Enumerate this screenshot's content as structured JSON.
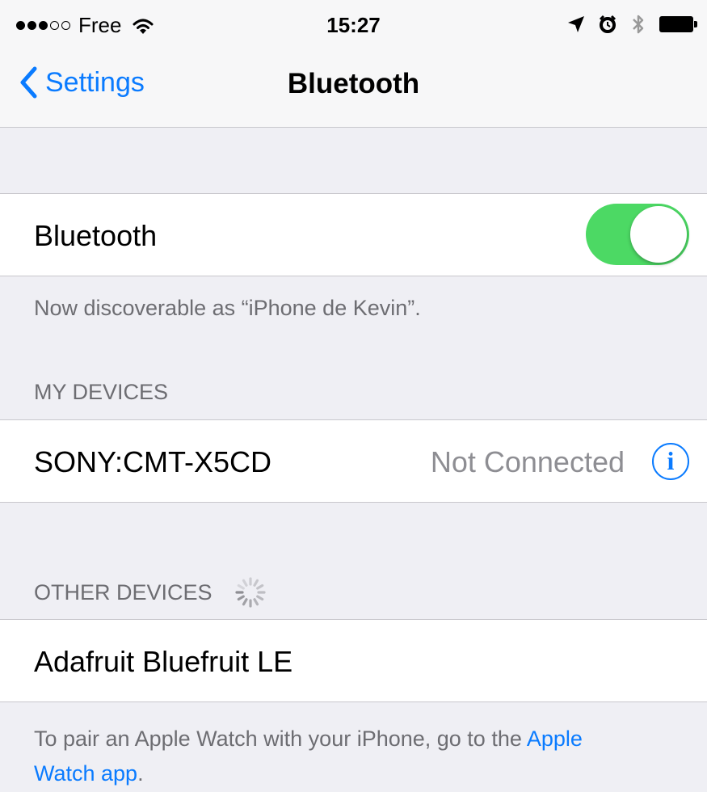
{
  "status_bar": {
    "carrier": "Free",
    "time": "15:27"
  },
  "nav": {
    "back_label": "Settings",
    "title": "Bluetooth"
  },
  "bluetooth_row": {
    "label": "Bluetooth",
    "toggle_on": true
  },
  "discoverable_text": "Now discoverable as “iPhone de Kevin”.",
  "my_devices": {
    "header": "MY DEVICES",
    "items": [
      {
        "name": "SONY:CMT-X5CD",
        "status": "Not Connected",
        "info_glyph": "i"
      }
    ]
  },
  "other_devices": {
    "header": "OTHER DEVICES",
    "items": [
      {
        "name": "Adafruit Bluefruit LE"
      }
    ]
  },
  "footer": {
    "text_before": "To pair an Apple Watch with your iPhone, go to the ",
    "link_part1": "Apple",
    "link_part2": "Watch app",
    "text_after": "."
  },
  "colors": {
    "accent": "#0a7bff",
    "toggle_on": "#4cd964",
    "background": "#efeff4"
  },
  "icons": [
    "signal-dots-icon",
    "wifi-icon",
    "location-arrow-icon",
    "alarm-icon",
    "bluetooth-icon",
    "battery-icon",
    "chevron-left-icon",
    "info-icon",
    "spinner-icon"
  ]
}
